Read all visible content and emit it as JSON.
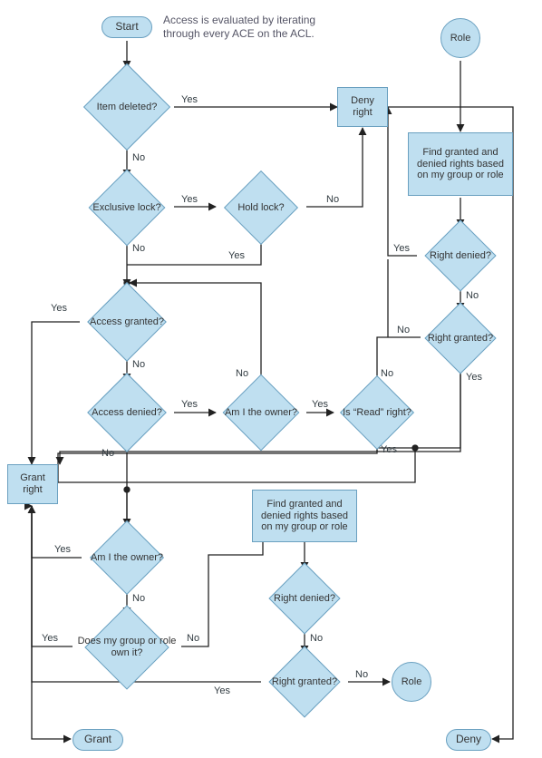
{
  "caption": "Access is evaluated by iterating through every ACE on the ACL.",
  "terminals": {
    "start": "Start",
    "grant": "Grant",
    "deny": "Deny"
  },
  "connectors": {
    "role_in": "Role",
    "role_out": "Role"
  },
  "processes": {
    "deny_right": "Deny right",
    "grant_right": "Grant right",
    "find_rights_1": "Find granted and denied rights based on my group or role",
    "find_rights_2": "Find granted and denied rights based on my group or role"
  },
  "decisions": {
    "item_deleted": "Item deleted?",
    "exclusive_lock": "Exclusive lock?",
    "hold_lock": "Hold lock?",
    "right_denied_1": "Right denied?",
    "right_granted_1": "Right granted?",
    "access_granted": "Access granted?",
    "access_denied": "Access denied?",
    "am_i_owner_1": "Am I the owner?",
    "is_read_right": "Is “Read” right?",
    "am_i_owner_2": "Am I the owner?",
    "group_own": "Does my group or role own  it?",
    "right_denied_2": "Right denied?",
    "right_granted_2": "Right granted?"
  },
  "edge_labels": {
    "yes": "Yes",
    "no": "No"
  },
  "chart_data": {
    "type": "flowchart",
    "title": "Access evaluation by iterating ACEs on the ACL",
    "nodes": [
      {
        "id": "start",
        "kind": "terminal",
        "label": "Start"
      },
      {
        "id": "role_in",
        "kind": "connector",
        "label": "Role"
      },
      {
        "id": "item_deleted",
        "kind": "decision",
        "label": "Item deleted?"
      },
      {
        "id": "deny_right",
        "kind": "process",
        "label": "Deny right"
      },
      {
        "id": "exclusive_lock",
        "kind": "decision",
        "label": "Exclusive lock?"
      },
      {
        "id": "hold_lock",
        "kind": "decision",
        "label": "Hold lock?"
      },
      {
        "id": "find_rights_1",
        "kind": "process",
        "label": "Find granted and denied rights based on my group or role"
      },
      {
        "id": "right_denied_1",
        "kind": "decision",
        "label": "Right denied?"
      },
      {
        "id": "right_granted_1",
        "kind": "decision",
        "label": "Right granted?"
      },
      {
        "id": "access_granted",
        "kind": "decision",
        "label": "Access granted?"
      },
      {
        "id": "access_denied",
        "kind": "decision",
        "label": "Access denied?"
      },
      {
        "id": "am_i_owner_1",
        "kind": "decision",
        "label": "Am I the owner?"
      },
      {
        "id": "is_read_right",
        "kind": "decision",
        "label": "Is \"Read\" right?"
      },
      {
        "id": "grant_right",
        "kind": "process",
        "label": "Grant right"
      },
      {
        "id": "am_i_owner_2",
        "kind": "decision",
        "label": "Am I the owner?"
      },
      {
        "id": "group_own",
        "kind": "decision",
        "label": "Does my group or role own it?"
      },
      {
        "id": "find_rights_2",
        "kind": "process",
        "label": "Find granted and denied rights based on my group or role"
      },
      {
        "id": "right_denied_2",
        "kind": "decision",
        "label": "Right denied?"
      },
      {
        "id": "right_granted_2",
        "kind": "decision",
        "label": "Right granted?"
      },
      {
        "id": "role_out",
        "kind": "connector",
        "label": "Role"
      },
      {
        "id": "grant",
        "kind": "terminal",
        "label": "Grant"
      },
      {
        "id": "deny",
        "kind": "terminal",
        "label": "Deny"
      }
    ],
    "edges": [
      {
        "from": "start",
        "to": "item_deleted"
      },
      {
        "from": "item_deleted",
        "to": "deny_right",
        "label": "Yes"
      },
      {
        "from": "item_deleted",
        "to": "exclusive_lock",
        "label": "No"
      },
      {
        "from": "exclusive_lock",
        "to": "hold_lock",
        "label": "Yes"
      },
      {
        "from": "exclusive_lock",
        "to": "access_granted",
        "label": "No",
        "note": "merge point before access_granted"
      },
      {
        "from": "hold_lock",
        "to": "deny_right",
        "label": "No"
      },
      {
        "from": "hold_lock",
        "to": "access_granted",
        "label": "Yes",
        "note": "via merge"
      },
      {
        "from": "role_in",
        "to": "find_rights_1"
      },
      {
        "from": "find_rights_1",
        "to": "right_denied_1"
      },
      {
        "from": "right_denied_1",
        "to": "deny_right",
        "label": "Yes"
      },
      {
        "from": "right_denied_1",
        "to": "right_granted_1",
        "label": "No"
      },
      {
        "from": "right_granted_1",
        "to": "deny_right",
        "label": "No"
      },
      {
        "from": "right_granted_1",
        "to": "is_read_right",
        "label": "Yes",
        "note": "via junction"
      },
      {
        "from": "access_granted",
        "to": "grant_right",
        "label": "Yes"
      },
      {
        "from": "access_granted",
        "to": "access_denied",
        "label": "No"
      },
      {
        "from": "access_denied",
        "to": "am_i_owner_2",
        "label": "No",
        "note": "via lower merge"
      },
      {
        "from": "access_denied",
        "to": "am_i_owner_1",
        "label": "Yes"
      },
      {
        "from": "am_i_owner_1",
        "to": "access_granted",
        "label": "No",
        "note": "loop back via merge"
      },
      {
        "from": "am_i_owner_1",
        "to": "is_read_right",
        "label": "Yes"
      },
      {
        "from": "is_read_right",
        "to": "deny_right",
        "label": "No"
      },
      {
        "from": "is_read_right",
        "to": "grant_right",
        "label": "Yes",
        "note": "via junction"
      },
      {
        "from": "am_i_owner_2",
        "to": "grant_right",
        "label": "Yes"
      },
      {
        "from": "am_i_owner_2",
        "to": "group_own",
        "label": "No"
      },
      {
        "from": "group_own",
        "to": "grant_right",
        "label": "Yes"
      },
      {
        "from": "group_own",
        "to": "find_rights_2",
        "label": "No"
      },
      {
        "from": "find_rights_2",
        "to": "right_denied_2"
      },
      {
        "from": "right_denied_2",
        "to": "deny_right",
        "label": "Yes",
        "note": "routes up"
      },
      {
        "from": "right_denied_2",
        "to": "right_granted_2",
        "label": "No"
      },
      {
        "from": "right_granted_2",
        "to": "grant_right",
        "label": "Yes"
      },
      {
        "from": "right_granted_2",
        "to": "role_out",
        "label": "No"
      },
      {
        "from": "grant_right",
        "to": "grant"
      },
      {
        "from": "deny_right",
        "to": "deny"
      }
    ]
  }
}
